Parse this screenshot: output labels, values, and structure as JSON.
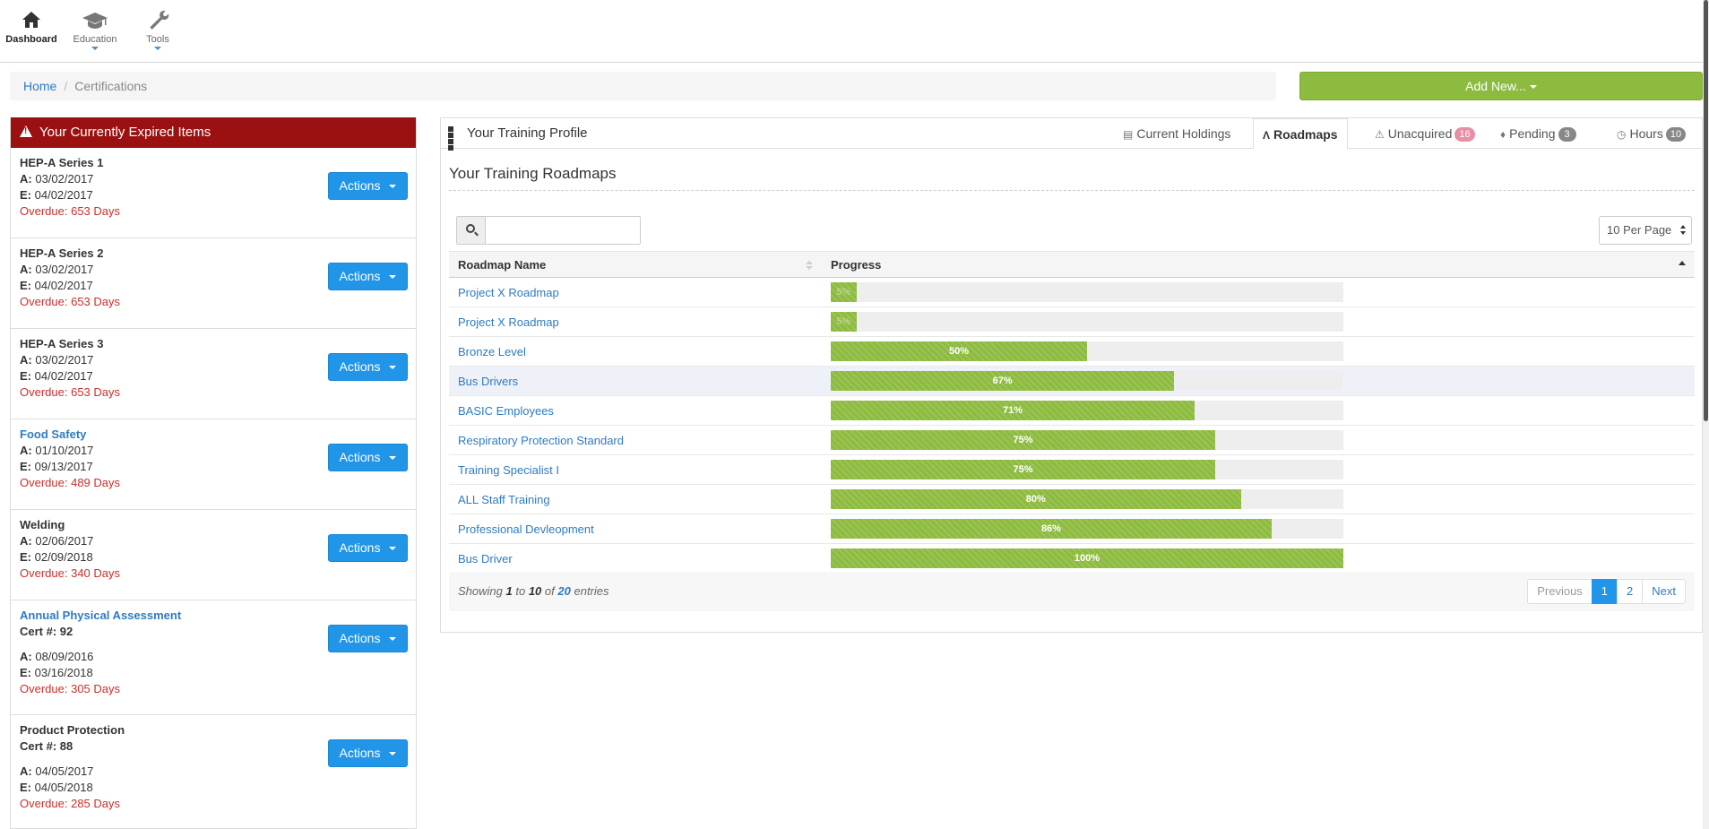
{
  "nav": {
    "items": [
      {
        "label": "Dashboard",
        "icon": "home-icon"
      },
      {
        "label": "Education",
        "icon": "graduation-cap-icon"
      },
      {
        "label": "Tools",
        "icon": "wrench-icon"
      }
    ]
  },
  "breadcrumb": {
    "home": "Home",
    "current": "Certifications"
  },
  "add_new": {
    "label": "Add New..."
  },
  "expired": {
    "title": "Your Currently Expired Items",
    "actions_label": "Actions",
    "items": [
      {
        "title": "HEP-A Series 1",
        "acquired_label": "A:",
        "acquired": "03/02/2017",
        "expires_label": "E:",
        "expires": "04/02/2017",
        "overdue": "Overdue: 653 Days"
      },
      {
        "title": "HEP-A Series 2",
        "acquired_label": "A:",
        "acquired": "03/02/2017",
        "expires_label": "E:",
        "expires": "04/02/2017",
        "overdue": "Overdue: 653 Days"
      },
      {
        "title": "HEP-A Series 3",
        "acquired_label": "A:",
        "acquired": "03/02/2017",
        "expires_label": "E:",
        "expires": "04/02/2017",
        "overdue": "Overdue: 653 Days"
      },
      {
        "title": "Food Safety",
        "acquired_label": "A:",
        "acquired": "01/10/2017",
        "expires_label": "E:",
        "expires": "09/13/2017",
        "overdue": "Overdue: 489 Days"
      },
      {
        "title": "Welding",
        "acquired_label": "A:",
        "acquired": "02/06/2017",
        "expires_label": "E:",
        "expires": "02/09/2018",
        "overdue": "Overdue: 340 Days"
      },
      {
        "title": "Annual Physical Assessment",
        "cert": "Cert #: 92",
        "acquired_label": "A:",
        "acquired": "08/09/2016",
        "expires_label": "E:",
        "expires": "03/16/2018",
        "overdue": "Overdue: 305 Days"
      },
      {
        "title": "Product Protection",
        "cert": "Cert #: 88",
        "acquired_label": "A:",
        "acquired": "04/05/2017",
        "expires_label": "E:",
        "expires": "04/05/2018",
        "overdue": "Overdue: 285 Days"
      }
    ]
  },
  "profile": {
    "title": "Your Training Profile",
    "tabs": {
      "holdings": "Current Holdings",
      "roadmaps": "Roadmaps",
      "unacquired": "Unacquired",
      "unacquired_count": "16",
      "pending": "Pending",
      "pending_count": "3",
      "hours": "Hours",
      "hours_count": "10"
    },
    "subtitle": "Your Training Roadmaps",
    "per_page": "10 Per Page",
    "columns": {
      "name": "Roadmap Name",
      "progress": "Progress"
    },
    "rows": [
      {
        "name": "Project X Roadmap",
        "progress": 5,
        "label": "5%"
      },
      {
        "name": "Project X Roadmap",
        "progress": 5,
        "label": "5%"
      },
      {
        "name": "Bronze Level",
        "progress": 50,
        "label": "50%"
      },
      {
        "name": "Bus Drivers",
        "progress": 67,
        "label": "67%"
      },
      {
        "name": "BASIC Employees",
        "progress": 71,
        "label": "71%"
      },
      {
        "name": "Respiratory Protection Standard",
        "progress": 75,
        "label": "75%"
      },
      {
        "name": "Training Specialist I",
        "progress": 75,
        "label": "75%"
      },
      {
        "name": "ALL Staff Training",
        "progress": 80,
        "label": "80%"
      },
      {
        "name": "Professional Devleopment",
        "progress": 86,
        "label": "86%"
      },
      {
        "name": "Bus Driver",
        "progress": 100,
        "label": "100%"
      }
    ],
    "footer": {
      "showing": "Showing",
      "from": "1",
      "to_word": "to",
      "to": "10",
      "of_word": "of",
      "total": "20",
      "entries": "entries"
    },
    "pager": {
      "previous": "Previous",
      "page1": "1",
      "page2": "2",
      "next": "Next"
    }
  }
}
